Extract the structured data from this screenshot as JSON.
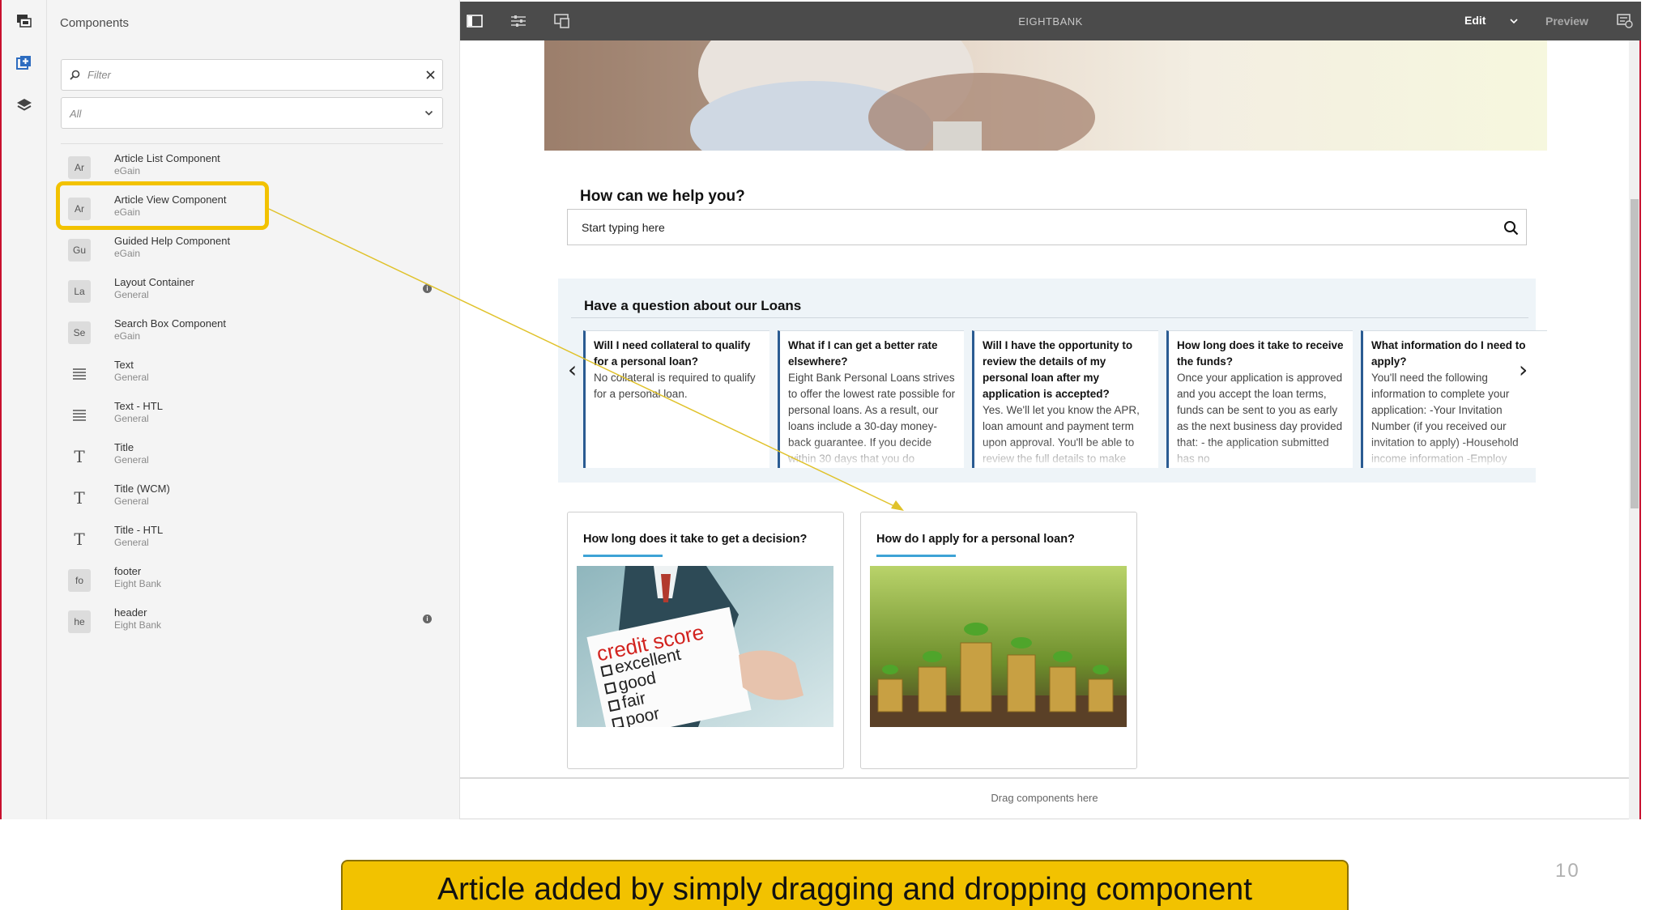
{
  "panel": {
    "title": "Components",
    "filter_placeholder": "Filter",
    "group_select_value": "All",
    "items": [
      {
        "badge": "Ar",
        "icon": "",
        "name": "Article List Component",
        "group": "eGain",
        "info": false
      },
      {
        "badge": "Ar",
        "icon": "",
        "name": "Article View Component",
        "group": "eGain",
        "info": false
      },
      {
        "badge": "Gu",
        "icon": "",
        "name": "Guided Help Component",
        "group": "eGain",
        "info": false
      },
      {
        "badge": "La",
        "icon": "",
        "name": "Layout Container",
        "group": "General",
        "info": true
      },
      {
        "badge": "Se",
        "icon": "",
        "name": "Search Box Component",
        "group": "eGain",
        "info": false
      },
      {
        "badge": "",
        "icon": "text-lines-icon",
        "name": "Text",
        "group": "General",
        "info": false
      },
      {
        "badge": "",
        "icon": "text-lines-icon",
        "name": "Text - HTL",
        "group": "General",
        "info": false
      },
      {
        "badge": "",
        "icon": "title-t-icon",
        "name": "Title",
        "group": "General",
        "info": false
      },
      {
        "badge": "",
        "icon": "title-t-icon",
        "name": "Title (WCM)",
        "group": "General",
        "info": false
      },
      {
        "badge": "",
        "icon": "title-t-icon",
        "name": "Title - HTL",
        "group": "General",
        "info": false
      },
      {
        "badge": "fo",
        "icon": "",
        "name": "footer",
        "group": "Eight Bank",
        "info": false
      },
      {
        "badge": "he",
        "icon": "",
        "name": "header",
        "group": "Eight Bank",
        "info": true
      }
    ]
  },
  "topbar": {
    "title": "EIGHTBANK",
    "edit_label": "Edit",
    "preview_label": "Preview"
  },
  "page": {
    "help_title": "How can we help you?",
    "search_placeholder": "Start typing here",
    "faq_title": "Have a question about our Loans",
    "faq_cards": [
      {
        "q": "Will I need collateral to qualify for a personal loan?",
        "a": "No collateral is required to qualify for a personal loan."
      },
      {
        "q": "What if I can get a better rate elsewhere?",
        "a": "Eight Bank Personal Loans strives to offer the lowest rate possible for personal loans. As a result, our loans include a 30-day money-back guarantee. If you decide within 30 days that you do"
      },
      {
        "q": "Will I have the opportunity to review the details of my personal loan after my application is accepted?",
        "a": "Yes. We'll let you know the APR, loan amount and payment term upon approval. You'll be able to review the full details to make"
      },
      {
        "q": "How long does it take to receive the funds?",
        "a": "Once your application is approved and you accept the loan terms, funds can be sent to you as early as the next business day provided that: - the application submitted has no"
      },
      {
        "q": "What information do I need to apply?",
        "a": "You'll need the following information to complete your application: -Your Invitation Number (if you received our invitation to apply) -Household income information -Employ"
      }
    ],
    "teasers": [
      {
        "title": "How long does it take to get a decision?",
        "image": "credit-score-card-image",
        "card_lines": [
          "credit score",
          "excellent",
          "good",
          "fair",
          "poor"
        ]
      },
      {
        "title": "How do I apply for a personal loan?",
        "image": "coins-seedlings-image"
      }
    ],
    "drag_hint": "Drag components here"
  },
  "caption": "Article added by simply dragging and dropping component",
  "page_number": "10",
  "colors": {
    "highlight": "#f2c200",
    "topbar": "#4b4b4b",
    "accent_underline": "#3ea3d6",
    "faq_border": "#2a5b92"
  }
}
